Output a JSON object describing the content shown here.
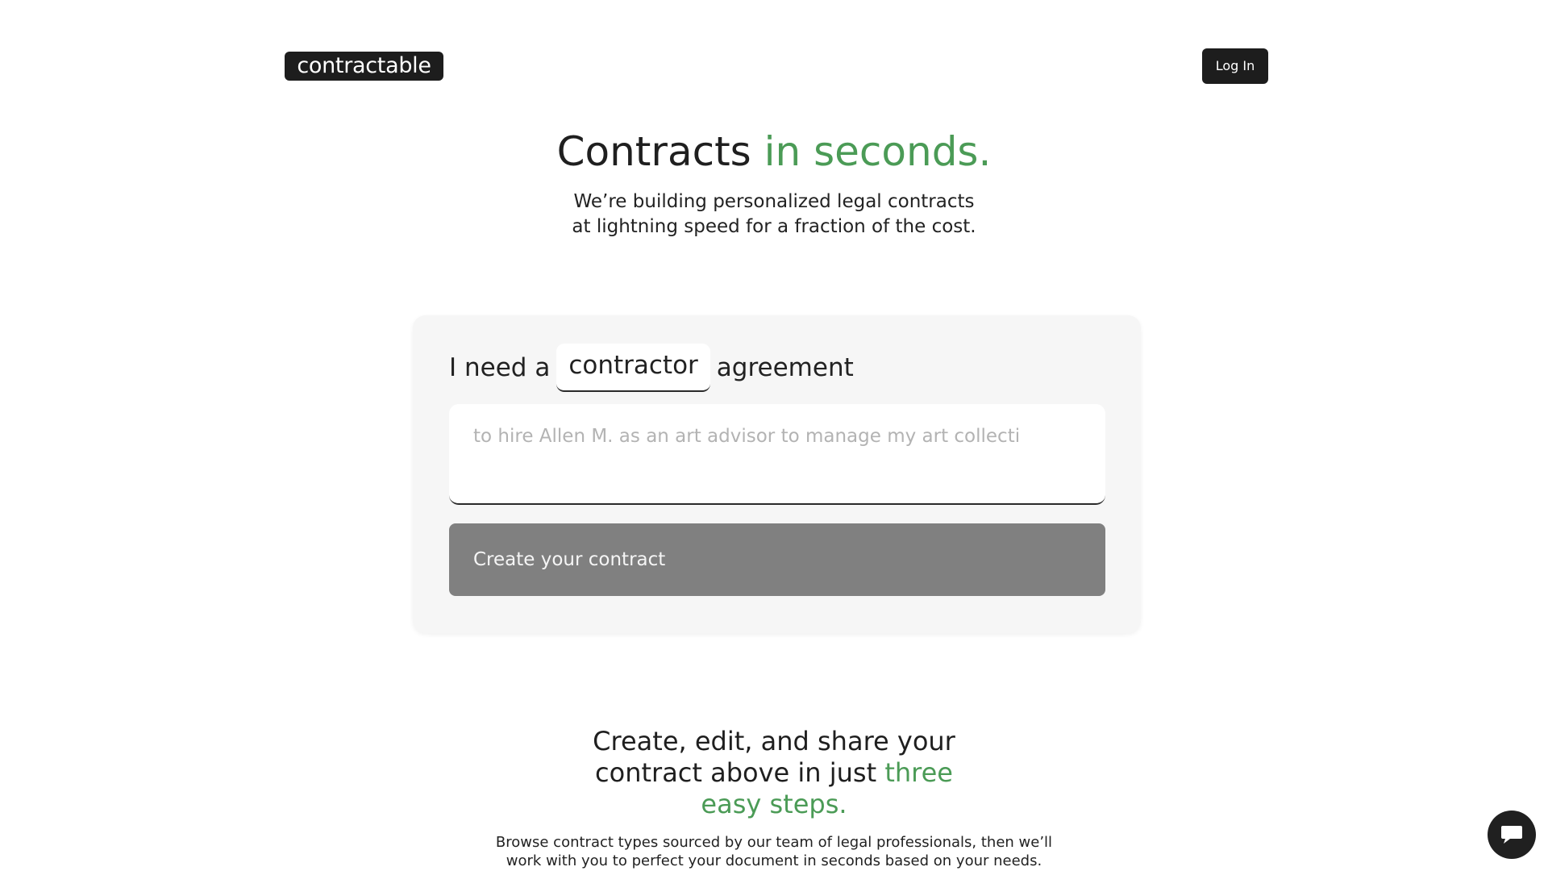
{
  "header": {
    "logo_text": "contractable",
    "login_label": "Log In"
  },
  "hero": {
    "title_main": "Contracts",
    "title_accent": "in seconds.",
    "subtitle_line1": "We’re building personalized legal contracts",
    "subtitle_line2": "at lightning speed for a fraction of the cost."
  },
  "card": {
    "prefix": "I need a",
    "contract_type": "contractor",
    "suffix": "agreement",
    "description_placeholder": "to hire Allen M. as an art advisor to manage my art collecti",
    "description_value": "",
    "create_label": "Create your contract"
  },
  "steps": {
    "line1": "Create, edit, and share your",
    "line2_main": "contract above in just",
    "line2_accent": "three",
    "line3_accent": "easy steps.",
    "desc_line1": "Browse contract types sourced by our team of legal professionals, then we’ll",
    "desc_line2": "work with you to perfect your document in seconds based on your needs."
  },
  "chat": {
    "icon": "chat-bubble-icon"
  },
  "colors": {
    "accent": "#4b9b56",
    "dark": "#1d1d1d",
    "button_disabled": "#808080",
    "card_bg": "#f6f6f6"
  }
}
